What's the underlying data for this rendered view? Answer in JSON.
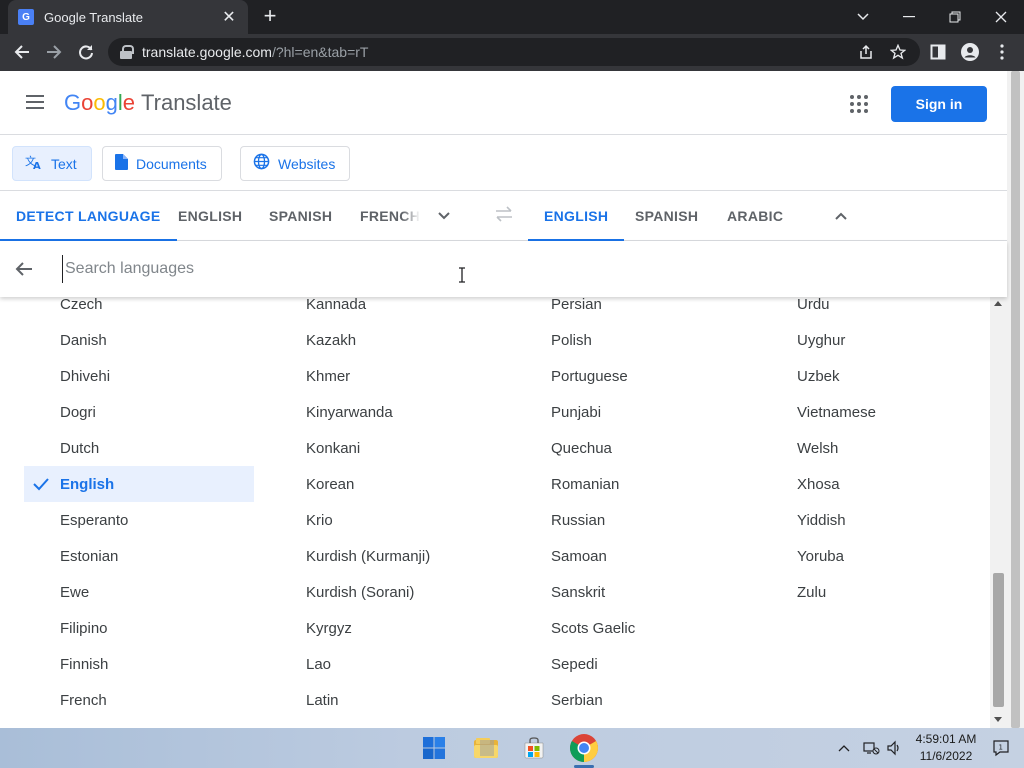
{
  "browser": {
    "tab_title": "Google Translate",
    "url_host": "translate.google.com",
    "url_path": "/?hl=en&tab=rT"
  },
  "header": {
    "logo_letters": [
      "G",
      "o",
      "o",
      "g",
      "l",
      "e"
    ],
    "product": "Translate",
    "signin_label": "Sign in"
  },
  "modes": [
    {
      "label": "Text",
      "icon": "translate-icon",
      "active": true
    },
    {
      "label": "Documents",
      "icon": "document-icon",
      "active": false
    },
    {
      "label": "Websites",
      "icon": "globe-icon",
      "active": false
    }
  ],
  "source_langs": [
    "DETECT LANGUAGE",
    "ENGLISH",
    "SPANISH",
    "FRENCH"
  ],
  "target_langs": [
    "ENGLISH",
    "SPANISH",
    "ARABIC"
  ],
  "search": {
    "placeholder": "Search languages",
    "value": ""
  },
  "language_columns": [
    [
      "Czech",
      "Danish",
      "Dhivehi",
      "Dogri",
      "Dutch",
      "English",
      "Esperanto",
      "Estonian",
      "Ewe",
      "Filipino",
      "Finnish",
      "French"
    ],
    [
      "Kannada",
      "Kazakh",
      "Khmer",
      "Kinyarwanda",
      "Konkani",
      "Korean",
      "Krio",
      "Kurdish (Kurmanji)",
      "Kurdish (Sorani)",
      "Kyrgyz",
      "Lao",
      "Latin"
    ],
    [
      "Persian",
      "Polish",
      "Portuguese",
      "Punjabi",
      "Quechua",
      "Romanian",
      "Russian",
      "Samoan",
      "Sanskrit",
      "Scots Gaelic",
      "Sepedi",
      "Serbian"
    ],
    [
      "Urdu",
      "Uyghur",
      "Uzbek",
      "Vietnamese",
      "Welsh",
      "Xhosa",
      "Yiddish",
      "Yoruba",
      "Zulu"
    ]
  ],
  "selected_language": "English",
  "taskbar": {
    "time": "4:59:01 AM",
    "date": "11/6/2022"
  },
  "colors": {
    "accent": "#1a73e8",
    "selected_bg": "#e8f0fe"
  }
}
